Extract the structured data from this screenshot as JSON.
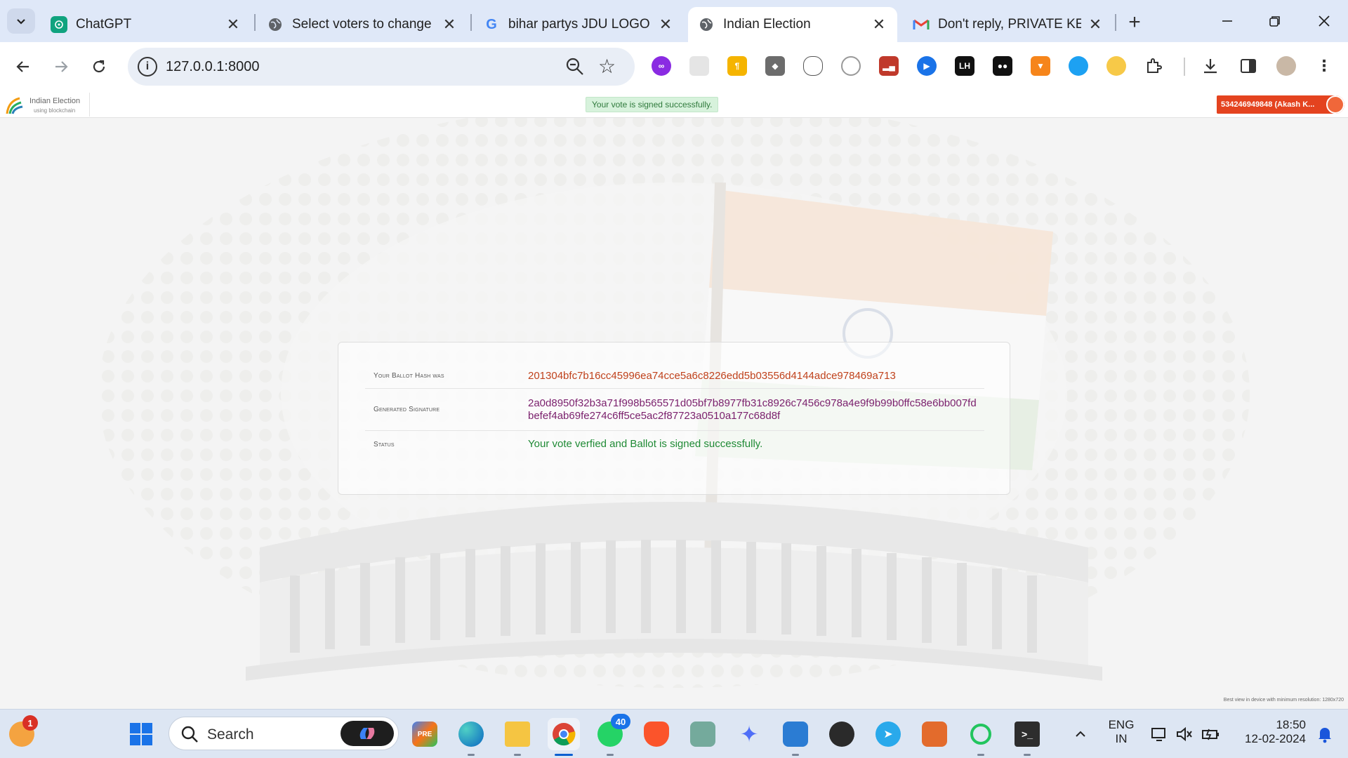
{
  "browser": {
    "tabs": [
      {
        "title": "ChatGPT",
        "favicon": "chatgpt-icon",
        "active": false
      },
      {
        "title": "Select voters to change |",
        "favicon": "globe-icon",
        "active": false
      },
      {
        "title": "bihar partys JDU LOGO -",
        "favicon": "google-icon",
        "active": false
      },
      {
        "title": "Indian Election",
        "favicon": "globe-icon",
        "active": true
      },
      {
        "title": "Don't reply, PRIVATE KEY",
        "favicon": "gmail-icon",
        "active": false
      }
    ],
    "close_glyph": "✕",
    "new_tab_glyph": "+",
    "url": "127.0.0.1:8000"
  },
  "site": {
    "brand_name": "Indian Election",
    "brand_sub": "using blockchain",
    "flash_message": "Your vote is signed successfully.",
    "user_badge": "534246949848 (Akash K..."
  },
  "result": {
    "rows": [
      {
        "label": "Your Ballot Hash was",
        "value": "201304bfc7b16cc45996ea74cce5a6c8226edd5b03556d4144adce978469a713"
      },
      {
        "label": "Generated Signature",
        "value": "2a0d8950f32b3a71f998b565571d05bf7b8977fb31c8926c7456c978a4e9f9b99b0ffc58e6bb007fdbefef4ab69fe274c6ff5ce5ac2f87723a0510a177c68d8f"
      },
      {
        "label": "Status",
        "value": "Your vote verfied and Ballot is signed successfully."
      }
    ]
  },
  "footnote": "Best view in device with minimum resolution: 1280x720",
  "taskbar": {
    "search_placeholder": "Search",
    "notification_count": "1",
    "whatsapp_count": "40",
    "lang_top": "ENG",
    "lang_bottom": "IN",
    "time": "18:50",
    "date": "12-02-2024"
  },
  "colors": {
    "accent_orange": "#e4431f",
    "hash_color": "#c0421c",
    "signature_color": "#7a1f6c",
    "status_color": "#1f8a35",
    "flash_bg": "#d7f2dc"
  }
}
